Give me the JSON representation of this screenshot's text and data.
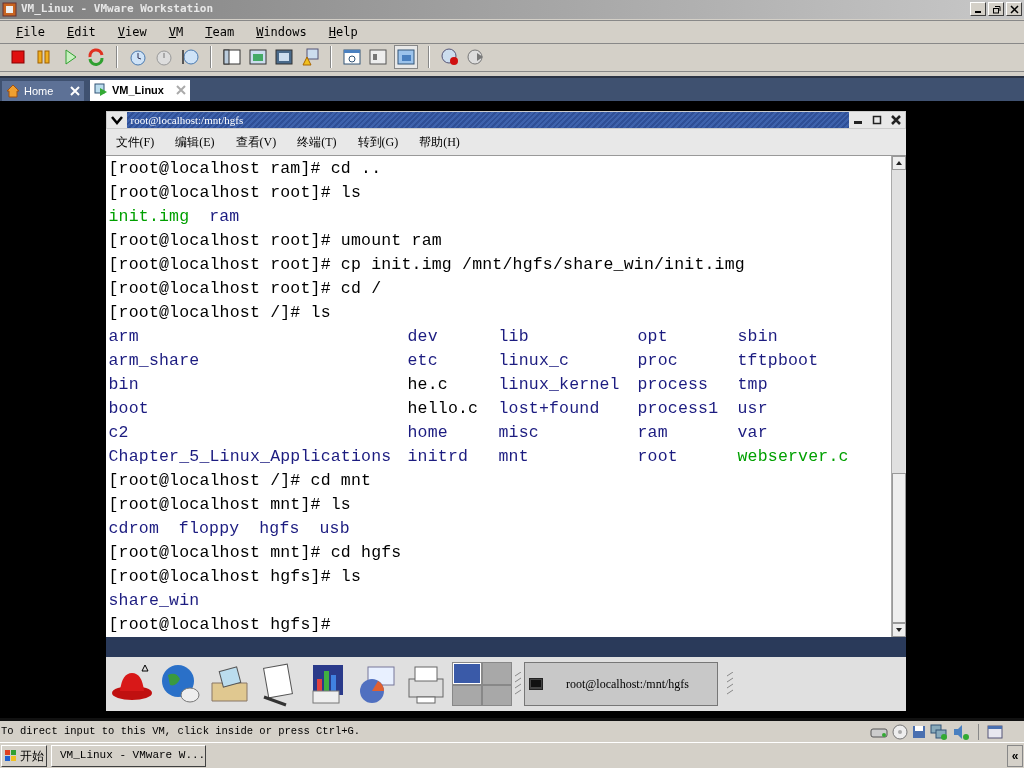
{
  "window": {
    "title": "VM_Linux - VMware Workstation"
  },
  "menu": [
    "File",
    "Edit",
    "View",
    "VM",
    "Team",
    "Windows",
    "Help"
  ],
  "tabs": [
    {
      "label": "Home",
      "selected": false
    },
    {
      "label": "VM_Linux",
      "selected": true
    }
  ],
  "guest": {
    "title": "root@localhost:/mnt/hgfs",
    "menu": [
      "文件(F)",
      "编辑(E)",
      "查看(V)",
      "终端(T)",
      "转到(G)",
      "帮助(H)"
    ],
    "lines": [
      {
        "kind": "text",
        "spans": [
          {
            "text": "[root@localhost ram]# cd ..",
            "color": "#000000"
          }
        ]
      },
      {
        "kind": "text",
        "spans": [
          {
            "text": "[root@localhost root]# ls",
            "color": "#000000"
          }
        ]
      },
      {
        "kind": "text",
        "spans": [
          {
            "text": "init.img",
            "color": "#00a000"
          },
          {
            "text": "ram",
            "color": "#1c1c80"
          }
        ]
      },
      {
        "kind": "text",
        "spans": [
          {
            "text": "[root@localhost root]# umount ram",
            "color": "#000000"
          }
        ]
      },
      {
        "kind": "text",
        "spans": [
          {
            "text": "[root@localhost root]# cp init.img /mnt/hgfs/share_win/init.img",
            "color": "#000000"
          }
        ]
      },
      {
        "kind": "text",
        "spans": [
          {
            "text": "[root@localhost root]# cd /",
            "color": "#000000"
          }
        ]
      },
      {
        "kind": "text",
        "spans": [
          {
            "text": "[root@localhost /]# ls",
            "color": "#000000"
          }
        ]
      },
      {
        "kind": "grid",
        "cells": [
          {
            "text": "arm",
            "color": "#1c1c80"
          },
          {
            "text": "dev",
            "color": "#1c1c80"
          },
          {
            "text": "lib",
            "color": "#1c1c80"
          },
          {
            "text": "opt",
            "color": "#1c1c80"
          },
          {
            "text": "sbin",
            "color": "#1c1c80"
          }
        ]
      },
      {
        "kind": "grid",
        "cells": [
          {
            "text": "arm_share",
            "color": "#1c1c80"
          },
          {
            "text": "etc",
            "color": "#1c1c80"
          },
          {
            "text": "linux_c",
            "color": "#1c1c80"
          },
          {
            "text": "proc",
            "color": "#1c1c80"
          },
          {
            "text": "tftpboot",
            "color": "#1c1c80"
          }
        ]
      },
      {
        "kind": "grid",
        "cells": [
          {
            "text": "bin",
            "color": "#1c1c80"
          },
          {
            "text": "he.c",
            "color": "#000000"
          },
          {
            "text": "linux_kernel",
            "color": "#1c1c80"
          },
          {
            "text": "process",
            "color": "#1c1c80"
          },
          {
            "text": "tmp",
            "color": "#1c1c80"
          }
        ]
      },
      {
        "kind": "grid",
        "cells": [
          {
            "text": "boot",
            "color": "#1c1c80"
          },
          {
            "text": "hello.c",
            "color": "#000000"
          },
          {
            "text": "lost+found",
            "color": "#1c1c80"
          },
          {
            "text": "process1",
            "color": "#1c1c80"
          },
          {
            "text": "usr",
            "color": "#1c1c80"
          }
        ]
      },
      {
        "kind": "grid",
        "cells": [
          {
            "text": "c2",
            "color": "#1c1c80"
          },
          {
            "text": "home",
            "color": "#1c1c80"
          },
          {
            "text": "misc",
            "color": "#1c1c80"
          },
          {
            "text": "ram",
            "color": "#1c1c80"
          },
          {
            "text": "var",
            "color": "#1c1c80"
          }
        ]
      },
      {
        "kind": "grid",
        "cells": [
          {
            "text": "Chapter_5_Linux_Applications",
            "color": "#1c1c80"
          },
          {
            "text": "initrd",
            "color": "#1c1c80"
          },
          {
            "text": "mnt",
            "color": "#1c1c80"
          },
          {
            "text": "root",
            "color": "#1c1c80"
          },
          {
            "text": "webserver.c",
            "color": "#00a000"
          }
        ]
      },
      {
        "kind": "text",
        "spans": [
          {
            "text": "[root@localhost /]# cd mnt",
            "color": "#000000"
          }
        ]
      },
      {
        "kind": "text",
        "spans": [
          {
            "text": "[root@localhost mnt]# ls",
            "color": "#000000"
          }
        ]
      },
      {
        "kind": "text",
        "spans": [
          {
            "text": "cdrom",
            "color": "#1c1c80"
          },
          {
            "text": "floppy",
            "color": "#1c1c80"
          },
          {
            "text": "hgfs",
            "color": "#1c1c80"
          },
          {
            "text": "usb",
            "color": "#1c1c80"
          }
        ]
      },
      {
        "kind": "text",
        "spans": [
          {
            "text": "[root@localhost mnt]# cd hgfs",
            "color": "#000000"
          }
        ]
      },
      {
        "kind": "text",
        "spans": [
          {
            "text": "[root@localhost hgfs]# ls",
            "color": "#000000"
          }
        ]
      },
      {
        "kind": "text",
        "spans": [
          {
            "text": "share_win",
            "color": "#1c1c80"
          }
        ]
      },
      {
        "kind": "text",
        "spans": [
          {
            "text": "[root@localhost hgfs]#",
            "color": "#000000"
          }
        ]
      }
    ],
    "panel": {
      "pager": [
        {
          "selected": true
        },
        {
          "selected": false
        },
        {
          "selected": false
        },
        {
          "selected": false
        }
      ],
      "task": "root@localhost:/mnt/hgfs"
    }
  },
  "status_bar": {
    "text": "To direct input to this VM, click inside or press Ctrl+G."
  },
  "taskbar": {
    "start": "开始",
    "task": "VM_Linux - VMware W...",
    "chevron": "«"
  }
}
